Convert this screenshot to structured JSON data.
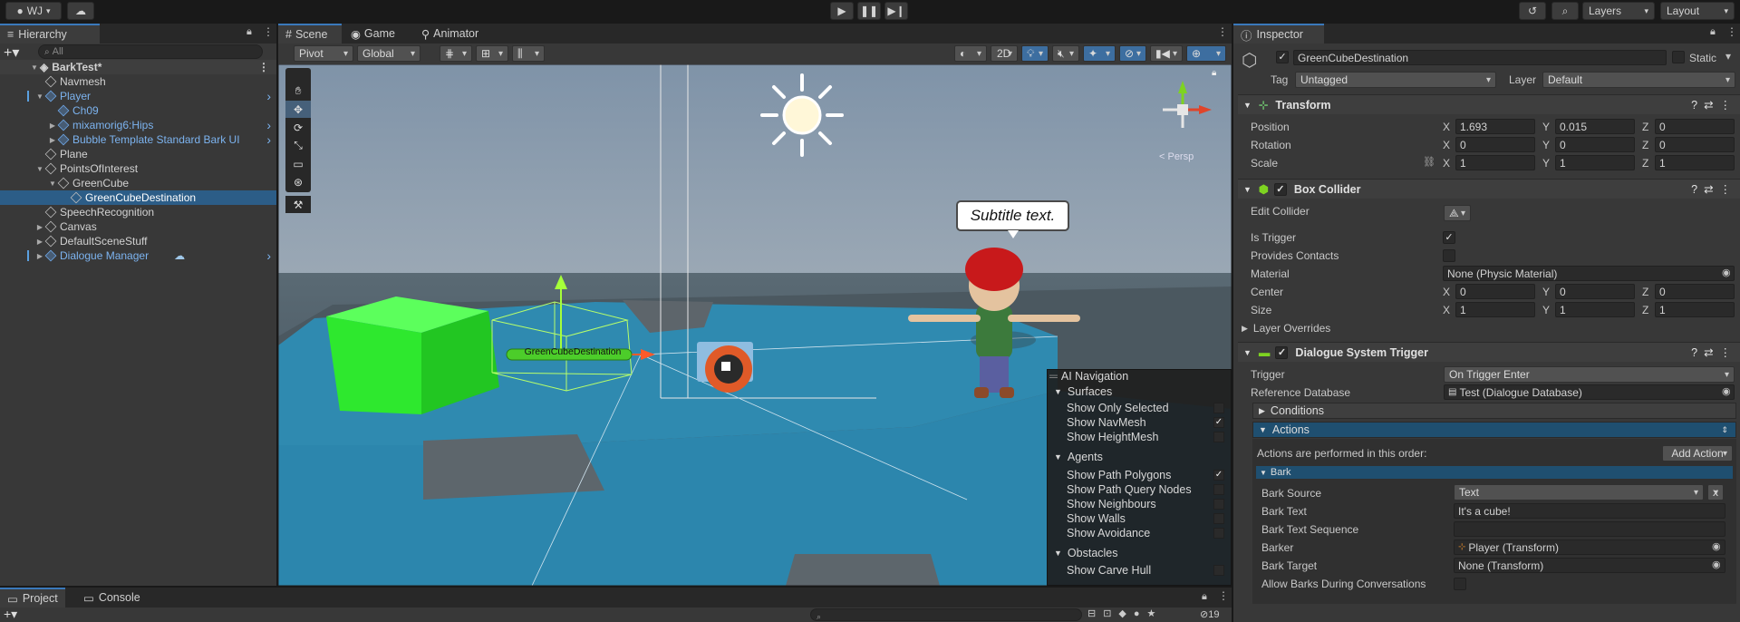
{
  "toolbar": {
    "account": "WJ",
    "layers": "Layers",
    "layout": "Layout"
  },
  "hierarchy": {
    "tab": "Hierarchy",
    "search_placeholder": "All",
    "scene": "BarkTest*",
    "items": [
      {
        "label": "Navmesh",
        "depth": 1
      },
      {
        "label": "Player",
        "depth": 1
      },
      {
        "label": "Ch09",
        "depth": 2
      },
      {
        "label": "mixamorig6:Hips",
        "depth": 2
      },
      {
        "label": "Bubble Template Standard Bark UI",
        "depth": 2
      },
      {
        "label": "Plane",
        "depth": 1
      },
      {
        "label": "PointsOfInterest",
        "depth": 1
      },
      {
        "label": "GreenCube",
        "depth": 2
      },
      {
        "label": "GreenCubeDestination",
        "depth": 3
      },
      {
        "label": "SpeechRecognition",
        "depth": 1
      },
      {
        "label": "Canvas",
        "depth": 1
      },
      {
        "label": "DefaultSceneStuff",
        "depth": 1
      },
      {
        "label": "Dialogue Manager",
        "depth": 1
      }
    ]
  },
  "scene_tabs": {
    "scene": "Scene",
    "game": "Game",
    "animator": "Animator"
  },
  "scene_toolbar": {
    "pivot": "Pivot",
    "global": "Global",
    "mode_2d": "2D"
  },
  "scene_view": {
    "subtitle": "Subtitle text.",
    "object_label": "GreenCubeDestination",
    "gizmo_label": "< Persp"
  },
  "ai_nav": {
    "title": "AI Navigation",
    "surfaces": "Surfaces",
    "show_only_selected": "Show Only Selected",
    "show_navmesh": "Show NavMesh",
    "show_heightmesh": "Show HeightMesh",
    "agents": "Agents",
    "show_path_polygons": "Show Path Polygons",
    "show_path_query_nodes": "Show Path Query Nodes",
    "show_neighbours": "Show Neighbours",
    "show_walls": "Show Walls",
    "show_avoidance": "Show Avoidance",
    "obstacles": "Obstacles",
    "show_carve_hull": "Show Carve Hull"
  },
  "inspector": {
    "tab": "Inspector",
    "object_name": "GreenCubeDestination",
    "static": "Static",
    "tag_label": "Tag",
    "tag_value": "Untagged",
    "layer_label": "Layer",
    "layer_value": "Default",
    "transform": {
      "title": "Transform",
      "position": "Position",
      "rotation": "Rotation",
      "scale": "Scale",
      "pos": [
        "1.693",
        "0.015",
        "0"
      ],
      "rot": [
        "0",
        "0",
        "0"
      ],
      "scl": [
        "1",
        "1",
        "1"
      ]
    },
    "axes": {
      "x": "X",
      "y": "Y",
      "z": "Z"
    },
    "box_collider": {
      "title": "Box Collider",
      "edit_collider": "Edit Collider",
      "is_trigger": "Is Trigger",
      "provides_contacts": "Provides Contacts",
      "material": "Material",
      "material_value": "None (Physic Material)",
      "center": "Center",
      "size": "Size",
      "center_vals": [
        "0",
        "0",
        "0"
      ],
      "size_vals": [
        "1",
        "1",
        "1"
      ],
      "layer_overrides": "Layer Overrides"
    },
    "dst": {
      "title": "Dialogue System Trigger",
      "trigger": "Trigger",
      "trigger_value": "On Trigger Enter",
      "reference_database": "Reference Database",
      "database_value": "Test (Dialogue Database)",
      "conditions": "Conditions",
      "actions": "Actions",
      "actions_info": "Actions are performed in this order:",
      "add_action": "Add Action",
      "bark": "Bark",
      "bark_source": "Bark Source",
      "bark_source_value": "Text",
      "bark_text": "Bark Text",
      "bark_text_value": "It's a cube!",
      "bark_text_sequence": "Bark Text Sequence",
      "barker": "Barker",
      "barker_value": "Player (Transform)",
      "bark_target": "Bark Target",
      "bark_target_value": "None (Transform)",
      "allow_barks": "Allow Barks During Conversations",
      "remove": "x"
    }
  },
  "bottom": {
    "project": "Project",
    "console": "Console",
    "count": "19"
  }
}
